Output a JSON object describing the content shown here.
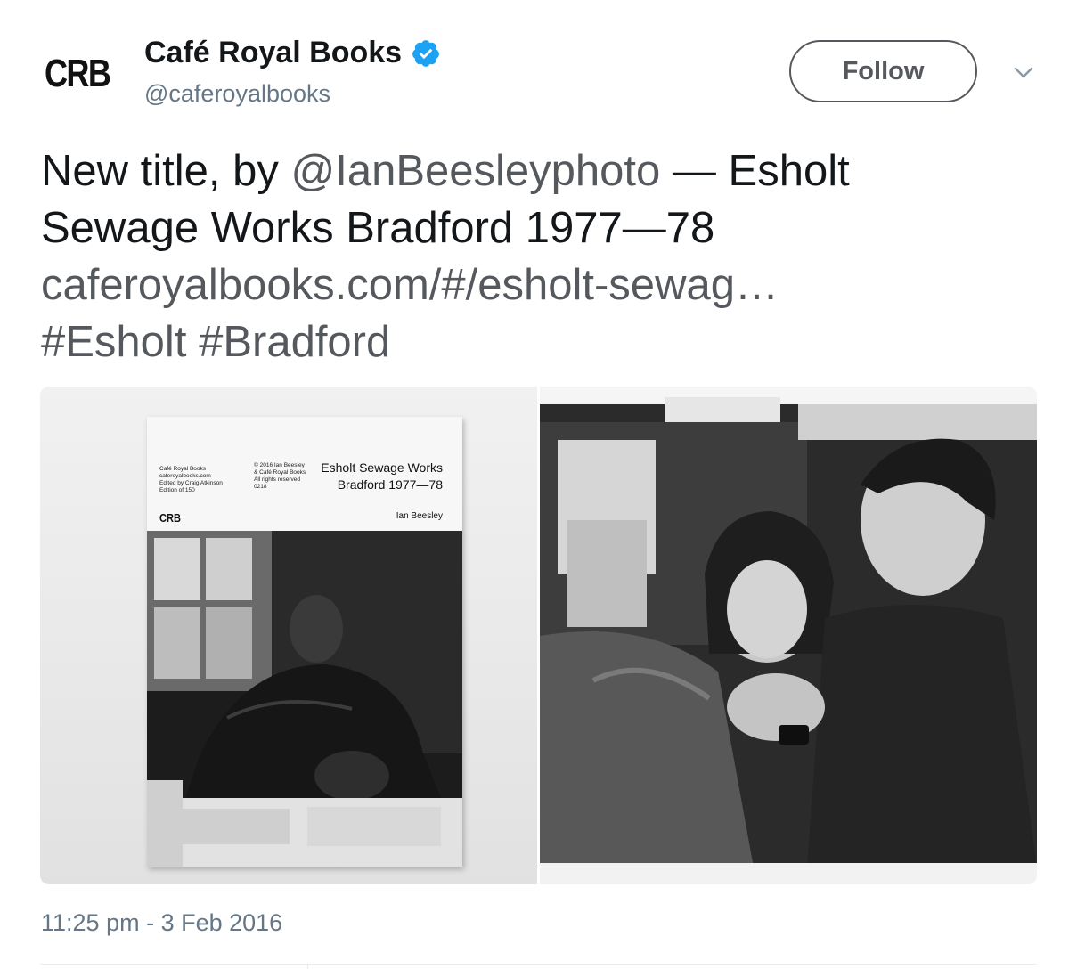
{
  "profile": {
    "avatar_text": "CRB",
    "display_name": "Café Royal Books",
    "handle": "@caferoyalbooks",
    "verified": true
  },
  "header": {
    "follow_label": "Follow"
  },
  "tweet": {
    "text_prefix": "New title, by ",
    "mention": "@IanBeesleyphoto",
    "text_mid": " — Esholt",
    "text_line2": "Sewage Works Bradford 1977—78",
    "url": "caferoyalbooks.com/#/esholt-sewag…",
    "hashtag1": "#Esholt",
    "hashtag2": "#Bradford"
  },
  "media": {
    "book_cover": {
      "publisher_lines": [
        "Café Royal Books",
        "caferoyalbooks.com",
        "Edited by Craig Atkinson",
        "Edition of 150"
      ],
      "copyright_lines": [
        "© 2016 Ian Beesley",
        "& Café Royal Books",
        "All rights reserved",
        "0218"
      ],
      "title": "Esholt Sewage Works Bradford 1977—78",
      "author": "Ian Beesley",
      "logo": "CRB"
    }
  },
  "footer": {
    "timestamp": "11:25 pm - 3 Feb 2016"
  },
  "colors": {
    "text": "#14171a",
    "secondary": "#657786",
    "link_grey": "#55595e",
    "verified_blue": "#1da1f2"
  }
}
